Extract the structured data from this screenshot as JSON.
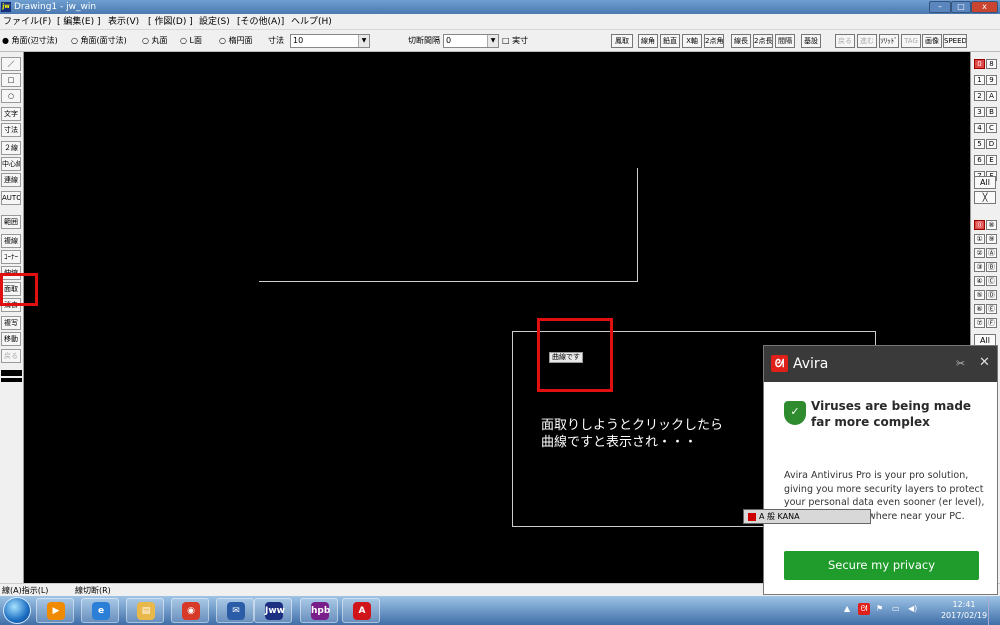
{
  "window": {
    "title": "Drawing1 - jw_win",
    "app_icon": "jw",
    "minimize": "–",
    "maximize": "□",
    "close": "x"
  },
  "menu": [
    "ファイル(F)",
    "[ 編集(E) ]",
    "表示(V)",
    "[ 作図(D) ]",
    "設定(S)",
    "[その他(A)]",
    "ヘルプ(H)"
  ],
  "toolbar": {
    "options": [
      "● 角面(辺寸法)",
      "○ 角面(面寸法)",
      "○ 丸面",
      "○ L面",
      "○ 楕円面"
    ],
    "dimension_label": "寸法",
    "dimension_value": "10",
    "cut_interval_label": "切断間隔",
    "cut_interval_value": "0",
    "actual_size_label": "□ 実寸",
    "right_buttons": [
      "鳳取",
      "線角",
      "鉛直",
      "X軸",
      "2点角",
      "線長",
      "2点長",
      "間隔",
      "基設",
      "戻る",
      "進む",
      "ｿﾘｯﾄﾞ",
      "TAG",
      "画像",
      "SPEED"
    ]
  },
  "left_toolbar": [
    "／",
    "□",
    "○",
    "文字",
    "寸法",
    "２線",
    "中心線",
    "連線",
    "AUTO",
    "範囲",
    "複線",
    "ｺｰﾅｰ",
    "伸縮",
    "面取",
    "消去",
    "複写",
    "移動",
    "戻る"
  ],
  "right_toolbar": {
    "layer_group_buttons": [
      "0",
      "8",
      "1",
      "9",
      "2",
      "A",
      "3",
      "B",
      "4",
      "C",
      "5",
      "D",
      "6",
      "E",
      "7",
      "F"
    ],
    "layer_group_all": "All",
    "layer_group_x": "╳",
    "layer_buttons": [
      "⓪",
      "⑧",
      "①",
      "⑨",
      "②",
      "Ⓐ",
      "③",
      "Ⓑ",
      "④",
      "Ⓒ",
      "⑤",
      "Ⓓ",
      "⑥",
      "Ⓔ",
      "⑦",
      "Ⓕ"
    ],
    "layer_all": "All"
  },
  "popup": {
    "tooltip": "曲線です",
    "message_line1": "面取りしようとクリックしたら",
    "message_line2": "曲線ですと表示され・・・"
  },
  "status": {
    "left": "線(A)指示(L)",
    "right": "線切断(R)"
  },
  "taskbar": {
    "apps": [
      {
        "name": "media-player-icon",
        "glyph": "▶",
        "color": "#f08a00"
      },
      {
        "name": "internet-explorer-icon",
        "glyph": "e",
        "color": "#2b7fd6"
      },
      {
        "name": "file-explorer-icon",
        "glyph": "▤",
        "color": "#e8b84a"
      },
      {
        "name": "chrome-icon",
        "glyph": "◉",
        "color": "#d83a2a"
      },
      {
        "name": "thunderbird-icon",
        "glyph": "✉",
        "color": "#2a5ca8"
      },
      {
        "name": "jww-icon",
        "glyph": "Jww",
        "color": "#1c2f80"
      },
      {
        "name": "hpb-icon",
        "glyph": "hpb",
        "color": "#7a1f8a"
      },
      {
        "name": "acrobat-icon",
        "glyph": "A",
        "color": "#d0161b"
      }
    ],
    "time": "12:41",
    "date": "2017/02/19"
  },
  "avira": {
    "brand": "Avira",
    "headline": "Viruses are being made far more complex",
    "body": "Avira Antivirus Pro is your pro solution, giving you more security layers to protect your personal data even sooner (er level), before it gets anywhere near your PC.",
    "cta": "Secure my privacy"
  },
  "ime": {
    "text": "A 般 KANA"
  }
}
